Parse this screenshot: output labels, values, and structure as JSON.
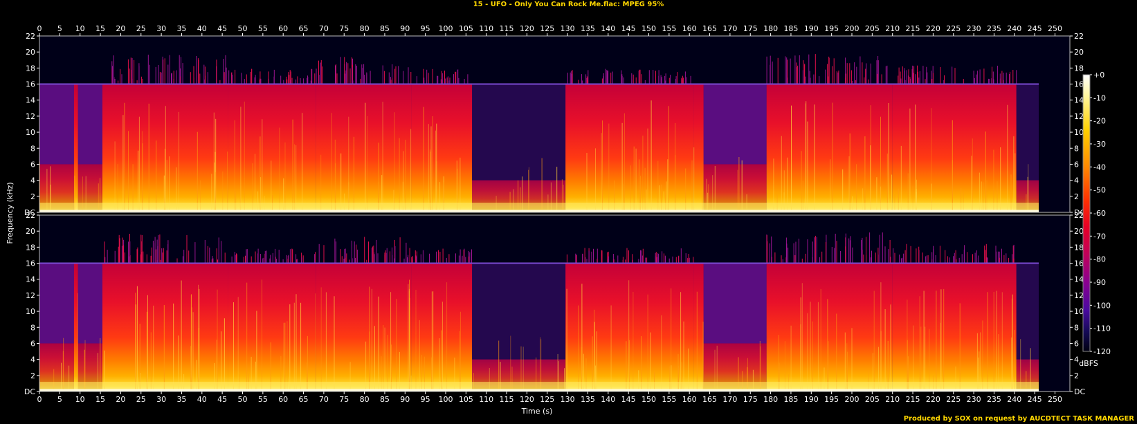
{
  "title": "15 - UFO - Only You Can Rock Me.flac: MPEG 95%",
  "credit": "Produced by SOX on request by AUCDTECT TASK MANAGER",
  "chart_data": {
    "type": "heatmap",
    "title": "15 - UFO - Only You Can Rock Me.flac: MPEG 95%",
    "xlabel": "Time (s)",
    "ylabel": "Frequency (kHz)",
    "xlim": [
      0,
      254
    ],
    "ylim": [
      0,
      22
    ],
    "x_ticks": [
      0,
      5,
      10,
      15,
      20,
      25,
      30,
      35,
      40,
      45,
      50,
      55,
      60,
      65,
      70,
      75,
      80,
      85,
      90,
      95,
      100,
      105,
      110,
      115,
      120,
      125,
      130,
      135,
      140,
      145,
      150,
      155,
      160,
      165,
      170,
      175,
      180,
      185,
      190,
      195,
      200,
      205,
      210,
      215,
      220,
      225,
      230,
      235,
      240,
      245,
      250
    ],
    "y_ticks": [
      "DC",
      "2",
      "4",
      "6",
      "8",
      "10",
      "12",
      "14",
      "16",
      "18",
      "20",
      "22"
    ],
    "channels": 2,
    "colorbar": {
      "label": "dBFS",
      "range": [
        -120,
        0
      ],
      "ticks": [
        "+0",
        "-10",
        "-20",
        "-30",
        "-40",
        "-50",
        "-60",
        "-70",
        "-80",
        "-90",
        "-100",
        "-110",
        "-120"
      ]
    },
    "cutoff_khz": 16,
    "audio_end_s": 246,
    "segments": [
      {
        "start": 0,
        "end": 8.5,
        "level": 0.55
      },
      {
        "start": 8.5,
        "end": 9.5,
        "level": 0.8
      },
      {
        "start": 9.5,
        "end": 15.5,
        "level": 0.5
      },
      {
        "start": 15.5,
        "end": 46.5,
        "level": 0.92,
        "peak_khz": 19.3
      },
      {
        "start": 46.5,
        "end": 68,
        "level": 0.82,
        "peak_khz": 17.5
      },
      {
        "start": 68,
        "end": 91.5,
        "level": 0.9,
        "peak_khz": 19
      },
      {
        "start": 91.5,
        "end": 106.5,
        "level": 0.82,
        "peak_khz": 17.5
      },
      {
        "start": 106.5,
        "end": 129.5,
        "level": 0.4
      },
      {
        "start": 129.5,
        "end": 161,
        "level": 0.82,
        "peak_khz": 17.5
      },
      {
        "start": 161,
        "end": 163.5,
        "level": 0.7
      },
      {
        "start": 163.5,
        "end": 179,
        "level": 0.55
      },
      {
        "start": 179,
        "end": 210,
        "level": 0.9,
        "peak_khz": 19.5
      },
      {
        "start": 210,
        "end": 240.5,
        "level": 0.85,
        "peak_khz": 18
      },
      {
        "start": 240.5,
        "end": 246,
        "level": 0.35
      }
    ]
  }
}
